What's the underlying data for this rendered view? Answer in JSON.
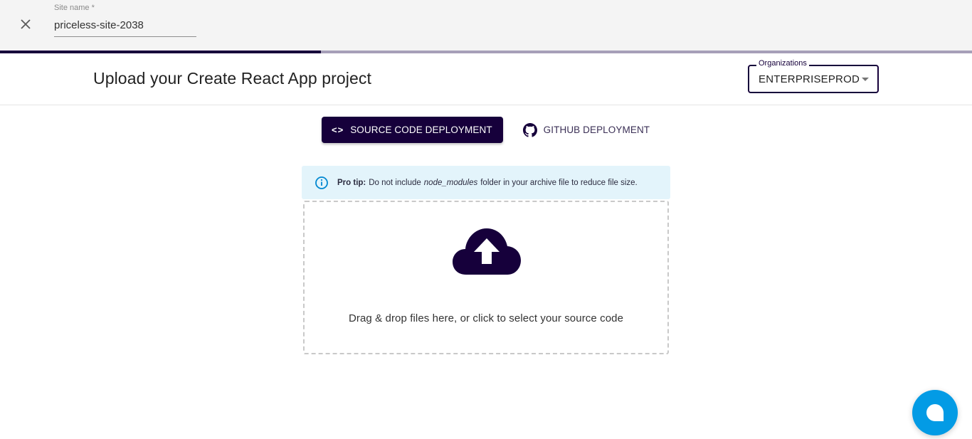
{
  "topbar": {
    "close_icon": "close-icon",
    "site_name_label": "Site name *",
    "site_name_value": "priceless-site-2038"
  },
  "progress": {
    "percent": 33,
    "fill_color": "#16003b",
    "track_color": "#a69fb8"
  },
  "header": {
    "title": "Upload your Create React App project",
    "organizations": {
      "label": "Organizations",
      "selected": "ENTERPRISEPROD"
    }
  },
  "tabs": [
    {
      "label": "SOURCE CODE DEPLOYMENT",
      "icon": "code-icon",
      "glyph": "<>",
      "active": true
    },
    {
      "label": "GITHUB DEPLOYMENT",
      "icon": "github-icon",
      "active": false
    }
  ],
  "tip": {
    "icon": "info-icon",
    "prefix": "Pro tip:",
    "text_before": "Do not include",
    "emphasis": "node_modules",
    "text_after": "folder in your archive file to reduce file size."
  },
  "dropzone": {
    "icon": "cloud-upload-icon",
    "text": "Drag & drop files here, or click to select your source code"
  },
  "chat": {
    "icon": "chat-bubble-icon"
  },
  "colors": {
    "brand": "#16003b",
    "info_bg": "#e3f4fb",
    "chat": "#039be5"
  }
}
